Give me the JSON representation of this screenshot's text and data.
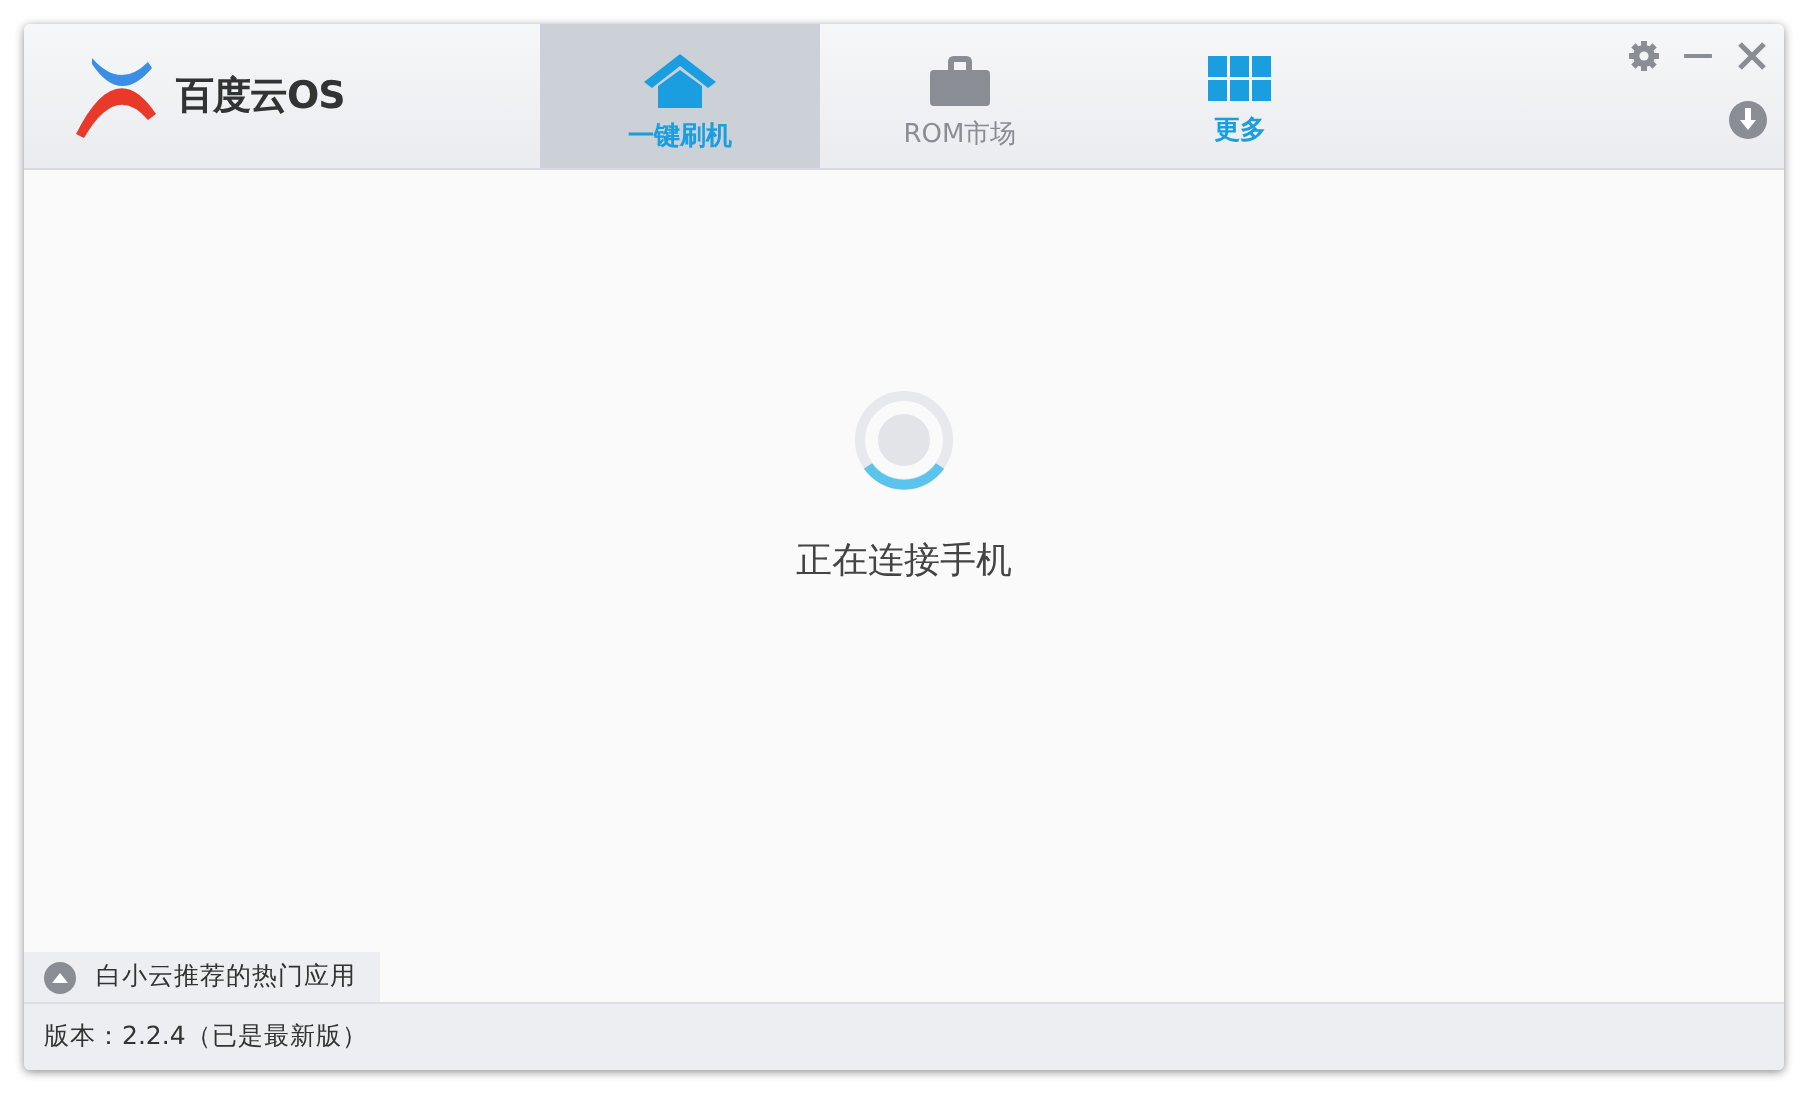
{
  "logo": {
    "text": "百度云OS"
  },
  "tabs": [
    {
      "kind": "home",
      "label": "一键刷机",
      "selected": true,
      "highlighted": true
    },
    {
      "kind": "bag",
      "label": "ROM市场",
      "selected": false,
      "highlighted": false
    },
    {
      "kind": "grid",
      "label": "更多",
      "selected": false,
      "highlighted": true
    }
  ],
  "status": {
    "message": "正在连接手机"
  },
  "recommend_toggle": {
    "label": "白小云推荐的热门应用",
    "expanded": false
  },
  "status_bar": {
    "version": "版本：2.2.4（已是最新版）"
  }
}
